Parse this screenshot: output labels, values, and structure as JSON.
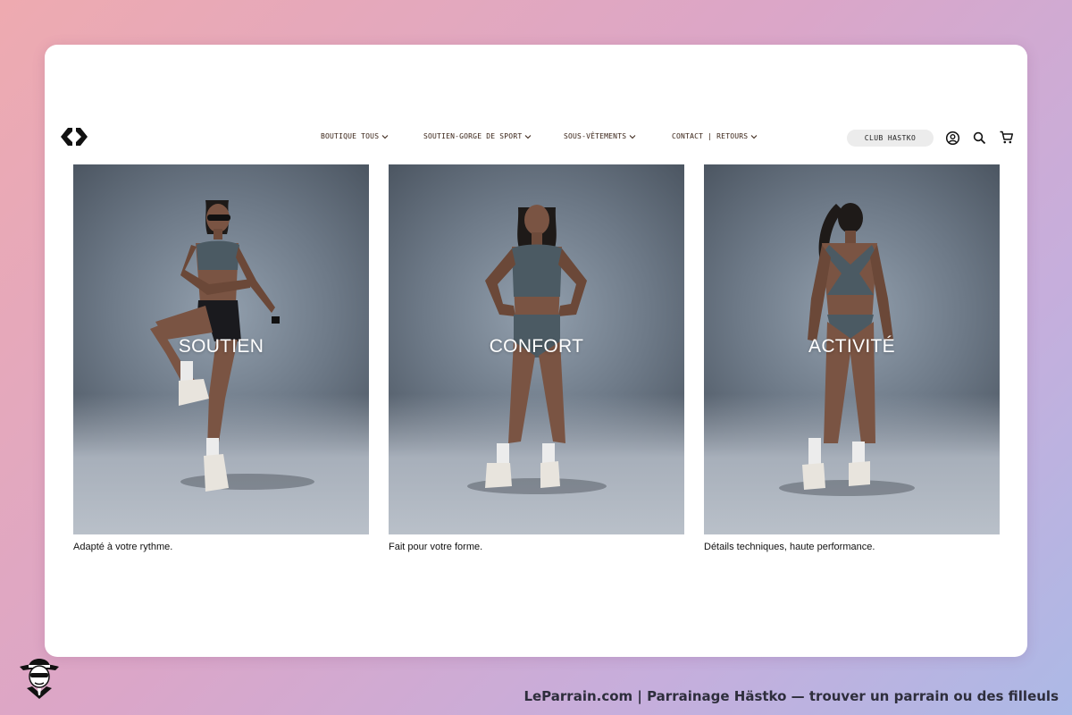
{
  "header": {
    "logo_icon": "brand-chevrons-logo",
    "nav": [
      {
        "label": "BOUTIQUE TOUS"
      },
      {
        "label": "SOUTIEN-GORGE DE SPORT"
      },
      {
        "label": "SOUS-VÊTEMENTS"
      },
      {
        "label": "CONTACT | RETOURS"
      }
    ],
    "club_button": "CLUB HASTKO",
    "icons": [
      "account-icon",
      "search-icon",
      "cart-icon"
    ]
  },
  "tiles": [
    {
      "title": "SOUTIEN",
      "caption": "Adapté à votre rythme."
    },
    {
      "title": "CONFORT",
      "caption": "Fait pour votre forme."
    },
    {
      "title": "ACTIVITÉ",
      "caption": "Détails techniques, haute performance."
    }
  ],
  "footer": {
    "text": "LeParrain.com | Parrainage Hästko — trouver un parrain ou des filleuls"
  },
  "colors": {
    "card_background": "#ffffff",
    "nav_text": "#3a2418",
    "club_button_bg": "#ececec",
    "photo_backdrop": "#6d7987",
    "garment": "#4b5a63"
  }
}
